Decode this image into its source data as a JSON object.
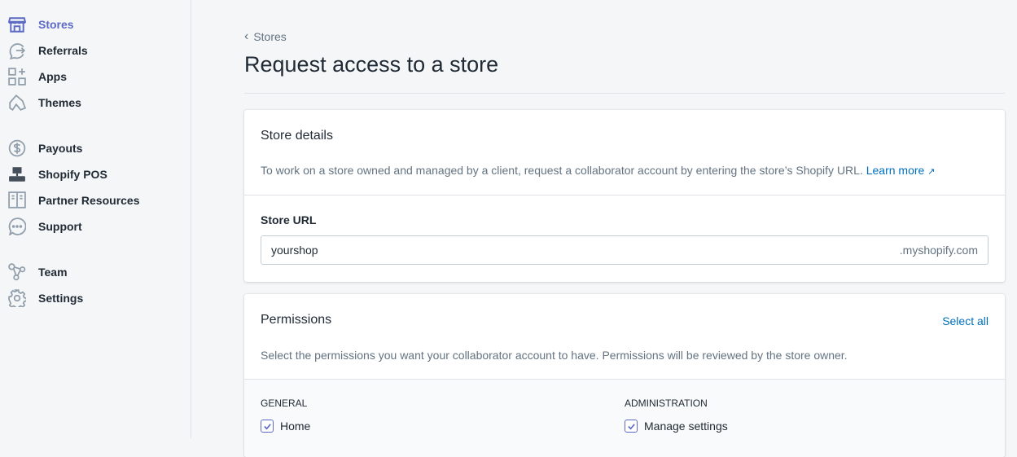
{
  "sidebar": {
    "items": [
      {
        "label": "Stores",
        "icon": "store-icon",
        "active": true
      },
      {
        "label": "Referrals",
        "icon": "referrals-icon"
      },
      {
        "label": "Apps",
        "icon": "apps-icon"
      },
      {
        "label": "Themes",
        "icon": "themes-icon"
      },
      {
        "label": "Payouts",
        "icon": "dollar-icon"
      },
      {
        "label": "Shopify POS",
        "icon": "pos-icon"
      },
      {
        "label": "Partner Resources",
        "icon": "book-icon"
      },
      {
        "label": "Support",
        "icon": "chat-icon"
      },
      {
        "label": "Team",
        "icon": "team-icon"
      },
      {
        "label": "Settings",
        "icon": "gear-icon"
      }
    ]
  },
  "breadcrumb": "Stores",
  "page_title": "Request access to a store",
  "store_details": {
    "title": "Store details",
    "description": "To work on a store owned and managed by a client, request a collaborator account by entering the store’s Shopify URL.",
    "learn_more": "Learn more",
    "url_label": "Store URL",
    "url_value": "yourshop",
    "url_suffix": ".myshopify.com"
  },
  "permissions": {
    "title": "Permissions",
    "select_all": "Select all",
    "description": "Select the permissions you want your collaborator account to have. Permissions will be reviewed by the store owner.",
    "general": {
      "heading": "GENERAL",
      "items": [
        {
          "label": "Home",
          "checked": true
        }
      ]
    },
    "administration": {
      "heading": "ADMINISTRATION",
      "items": [
        {
          "label": "Manage settings",
          "checked": true
        }
      ]
    }
  },
  "colors": {
    "accent": "#5c6ac4",
    "link": "#006fbb"
  }
}
